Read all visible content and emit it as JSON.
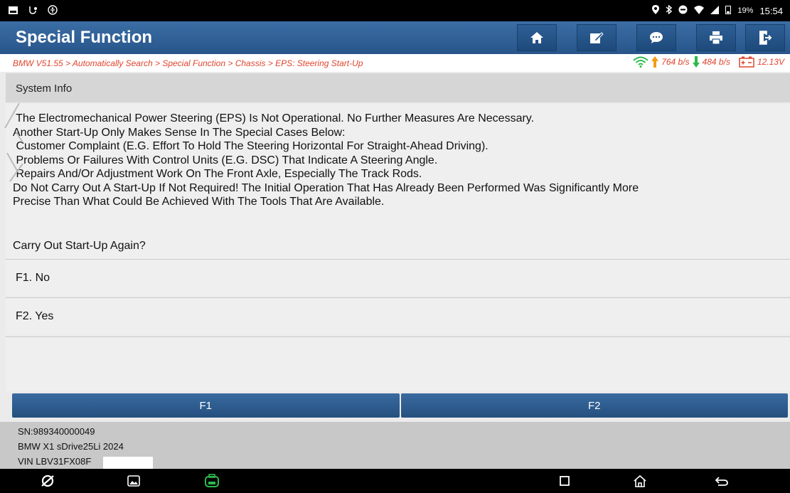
{
  "status": {
    "battery": "19%",
    "time": "15:54"
  },
  "header": {
    "title": "Special Function"
  },
  "toolbar": {
    "buttons": [
      {
        "icon": "home-icon"
      },
      {
        "icon": "edit-icon"
      },
      {
        "icon": "chat-icon"
      },
      {
        "icon": "print-icon"
      },
      {
        "icon": "exit-icon"
      }
    ]
  },
  "breadcrumb": {
    "text": "BMW V51.55 > Automatically Search > Special Function > Chassis > EPS: Steering Start-Up"
  },
  "network": {
    "upload": "764 b/s",
    "download": "484 b/s",
    "voltage": "12.13V"
  },
  "section": {
    "title": "System Info"
  },
  "message": {
    "lines": [
      " The Electromechanical Power Steering (EPS) Is Not Operational. No Further Measures Are Necessary.",
      "Another Start-Up Only Makes Sense In The Special Cases Below:",
      " Customer Complaint (E.G. Effort To Hold The Steering Horizontal For Straight-Ahead Driving).",
      " Problems Or Failures With Control Units (E.G. DSC) That Indicate A Steering Angle.",
      " Repairs And/Or Adjustment Work On The Front Axle, Especially The Track Rods.",
      "Do Not Carry Out A Start-Up If Not Required! The Initial Operation That Has Already Been Performed Was Significantly More",
      "Precise Than What Could Be Achieved With The Tools That Are Available."
    ],
    "question": "Carry Out Start-Up Again?"
  },
  "options": [
    {
      "label": "F1. No"
    },
    {
      "label": "F2. Yes"
    }
  ],
  "function_keys": [
    {
      "label": "F1"
    },
    {
      "label": "F2"
    }
  ],
  "footer": {
    "sn": "SN:989340000049",
    "vehicle": "BMW X1 sDrive25Li 2024",
    "vin": "VIN LBV31FX08F"
  },
  "colors": {
    "header": "#2f6299",
    "breadcrumb_text": "#e0452e",
    "upload": "#f39c12",
    "download": "#2db84c"
  }
}
